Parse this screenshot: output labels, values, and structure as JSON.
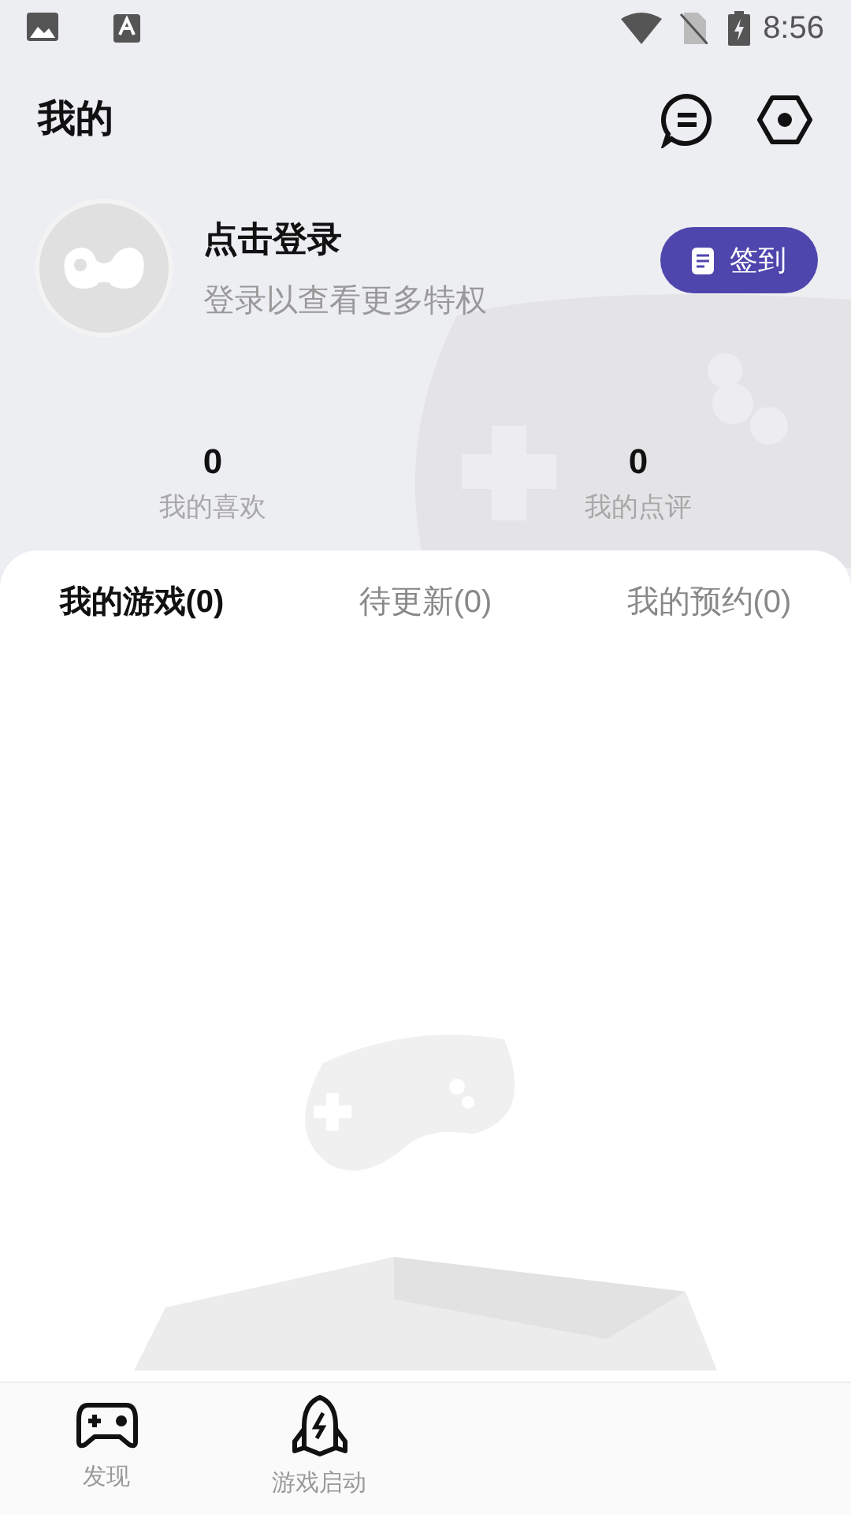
{
  "status_bar": {
    "time": "8:56"
  },
  "header": {
    "title": "我的"
  },
  "profile": {
    "name": "点击登录",
    "subtitle": "登录以查看更多特权",
    "checkin_button": "签到"
  },
  "stats": [
    {
      "value": "0",
      "label": "我的喜欢"
    },
    {
      "value": "0",
      "label": "我的点评"
    }
  ],
  "tabs": [
    {
      "label": "我的游戏(0)",
      "selected": true
    },
    {
      "label": "待更新(0)",
      "selected": false
    },
    {
      "label": "我的预约(0)",
      "selected": false
    }
  ],
  "bottom_nav": [
    {
      "label": "发现",
      "kind": "gamepad"
    },
    {
      "label": "游戏启动",
      "kind": "rocket"
    }
  ]
}
